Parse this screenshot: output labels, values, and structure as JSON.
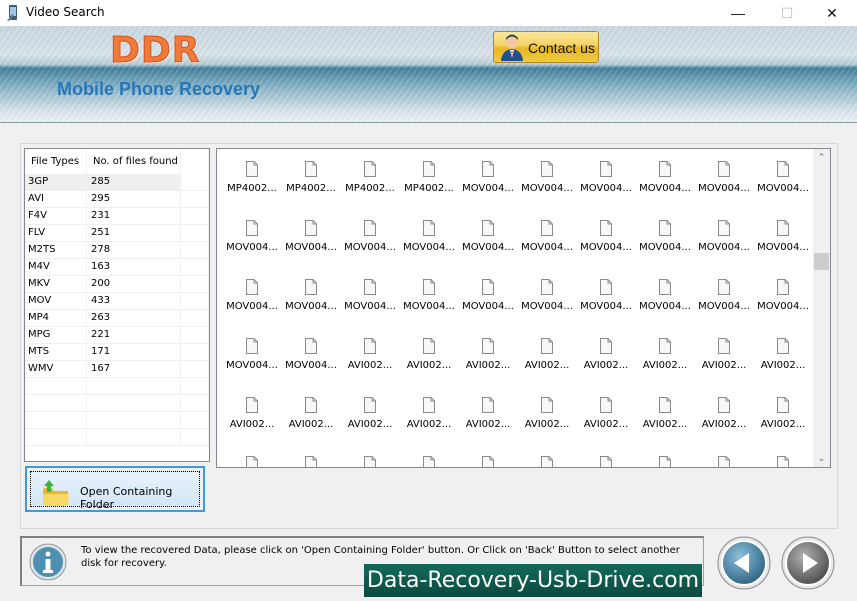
{
  "window": {
    "title": "Video Search",
    "controls": {
      "minimize": "—",
      "maximize": "☐",
      "close": "✕"
    }
  },
  "banner": {
    "logo": "DDR",
    "subtitle": "Mobile Phone Recovery",
    "contact_label": "Contact us"
  },
  "file_types_table": {
    "headers": [
      "File Types",
      "No. of files found"
    ],
    "rows": [
      {
        "type": "3GP",
        "count": "285"
      },
      {
        "type": "AVI",
        "count": "295"
      },
      {
        "type": "F4V",
        "count": "231"
      },
      {
        "type": "FLV",
        "count": "251"
      },
      {
        "type": "M2TS",
        "count": "278"
      },
      {
        "type": "M4V",
        "count": "163"
      },
      {
        "type": "MKV",
        "count": "200"
      },
      {
        "type": "MOV",
        "count": "433"
      },
      {
        "type": "MP4",
        "count": "263"
      },
      {
        "type": "MPG",
        "count": "221"
      },
      {
        "type": "MTS",
        "count": "171"
      },
      {
        "type": "WMV",
        "count": "167"
      }
    ],
    "selected_index": 0
  },
  "open_folder_button": {
    "label": "Open Containing Folder",
    "icon": "folder-open-icon"
  },
  "files_grid": {
    "rows": [
      [
        "MP4002...",
        "MP4002...",
        "MP4002...",
        "MP4002...",
        "MOV004...",
        "MOV004...",
        "MOV004...",
        "MOV004...",
        "MOV004...",
        "MOV004..."
      ],
      [
        "MOV004...",
        "MOV004...",
        "MOV004...",
        "MOV004...",
        "MOV004...",
        "MOV004...",
        "MOV004...",
        "MOV004...",
        "MOV004...",
        "MOV004..."
      ],
      [
        "MOV004...",
        "MOV004...",
        "MOV004...",
        "MOV004...",
        "MOV004...",
        "MOV004...",
        "MOV004...",
        "MOV004...",
        "MOV004...",
        "MOV004..."
      ],
      [
        "MOV004...",
        "MOV004...",
        "AVI002...",
        "AVI002...",
        "AVI002...",
        "AVI002...",
        "AVI002...",
        "AVI002...",
        "AVI002...",
        "AVI002..."
      ],
      [
        "AVI002...",
        "AVI002...",
        "AVI002...",
        "AVI002...",
        "AVI002...",
        "AVI002...",
        "AVI002...",
        "AVI002...",
        "AVI002...",
        "AVI002..."
      ],
      [
        "",
        "",
        "",
        "",
        "",
        "",
        "",
        "",
        "",
        ""
      ]
    ],
    "scroll_position": 0.33
  },
  "status": {
    "message": "To view the recovered Data, please click on 'Open Containing Folder' button. Or Click on 'Back' Button to select another disk for recovery.",
    "icon": "info-icon"
  },
  "watermark": "Data-Recovery-Usb-Drive.com",
  "nav": {
    "back": "back-button",
    "next": "next-button"
  }
}
